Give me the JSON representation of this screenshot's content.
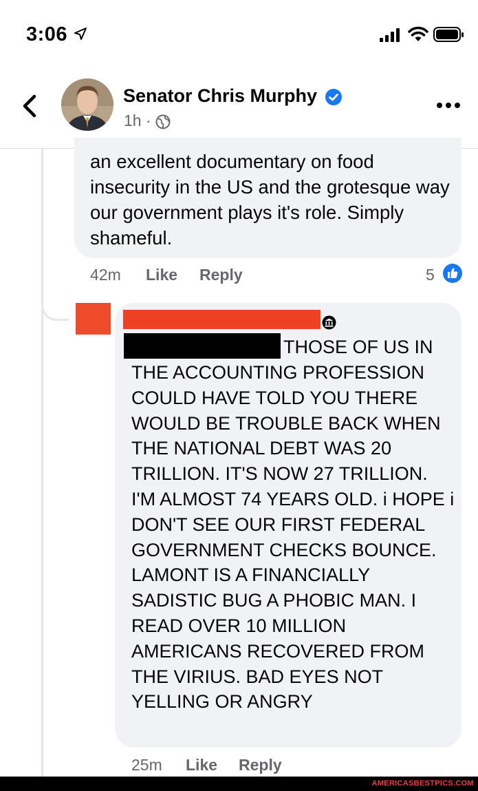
{
  "status_bar": {
    "time": "3:06"
  },
  "header": {
    "name": "Senator Chris Murphy",
    "meta": "1h ·"
  },
  "comments": [
    {
      "text": "an excellent documentary on food insecurity in the US and the grotesque way our government plays it's role. Simply shameful.",
      "time": "42m",
      "like_label": "Like",
      "reply_label": "Reply",
      "like_count": "5"
    },
    {
      "first_line": "THOSE OF US IN",
      "text": "THE ACCOUNTING PROFESSION COULD HAVE TOLD YOU THERE WOULD BE TROUBLE BACK WHEN THE NATIONAL DEBT WAS 20 TRILLION. IT'S NOW 27 TRILLION. I'M ALMOST 74 YEARS OLD. i HOPE i DON'T SEE OUR FIRST FEDERAL GOVERNMENT CHECKS BOUNCE. LAMONT IS A FINANCIALLY SADISTIC BUG A PHOBIC MAN. I READ OVER 10 MILLION AMERICANS RECOVERED FROM THE VIRIUS. BAD EYES NOT YELLING OR ANGRY",
      "time": "25m",
      "like_label": "Like",
      "reply_label": "Reply"
    }
  ],
  "watermark": "AMERICASBESTPICS.COM",
  "colors": {
    "accent_blue": "#1877f2",
    "redaction_red": "#ee4124",
    "bubble_bg": "#f0f2f5",
    "secondary_text": "#65676b"
  }
}
